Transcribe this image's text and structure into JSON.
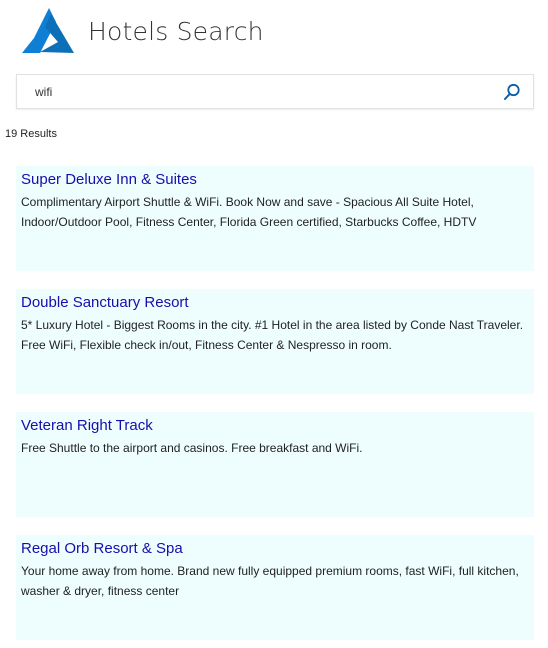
{
  "header": {
    "title": "Hotels Search"
  },
  "search": {
    "value": "wifi",
    "placeholder": ""
  },
  "results_count": "19 Results",
  "results": [
    {
      "title": "Super Deluxe Inn & Suites",
      "description": "Complimentary Airport Shuttle & WiFi.  Book Now and save - Spacious All Suite Hotel, Indoor/Outdoor Pool, Fitness Center, Florida Green certified, Starbucks Coffee, HDTV"
    },
    {
      "title": "Double Sanctuary Resort",
      "description": "5* Luxury Hotel - Biggest Rooms in the city.  #1 Hotel in the area listed by Conde Nast Traveler. Free WiFi, Flexible check in/out, Fitness Center & Nespresso in room."
    },
    {
      "title": "Veteran Right Track",
      "description": "Free Shuttle to the airport and casinos.  Free breakfast and WiFi."
    },
    {
      "title": "Regal Orb Resort & Spa",
      "description": "Your home away from home. Brand new fully equipped premium rooms, fast WiFi, full kitchen, washer & dryer, fitness center"
    }
  ],
  "colors": {
    "brand": "#0072c6",
    "link": "#1a0dab",
    "card_background": "#eefefe"
  },
  "icons": {
    "logo": "azure-logo-icon",
    "search": "search-icon"
  }
}
